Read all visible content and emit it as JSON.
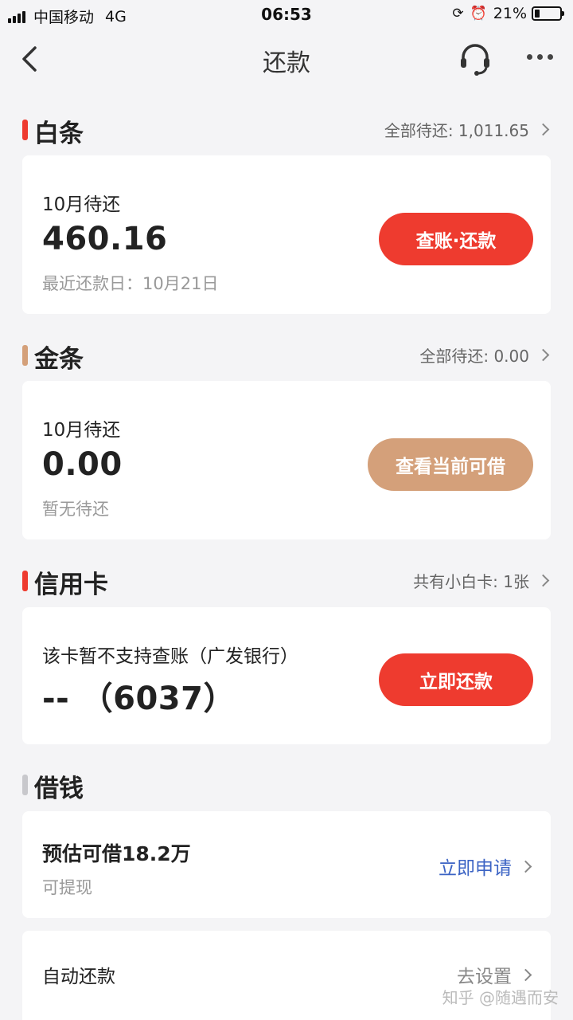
{
  "status_bar": {
    "carrier": "中国移动",
    "network": "4G",
    "time": "06:53",
    "battery": "21%",
    "battery_level": 0.21
  },
  "nav": {
    "title": "还款",
    "back_icon": "chevron-left-icon",
    "service_icon": "headset-icon",
    "more_icon": "more-dots-icon"
  },
  "baitiao": {
    "title": "白条",
    "summary": "全部待还: 1,011.65",
    "label": "10月待还",
    "amount": "460.16",
    "sub": "最近还款日：10月21日",
    "button": "查账·还款",
    "accent": "#ee3b2f"
  },
  "jintiao": {
    "title": "金条",
    "summary": "全部待还: 0.00",
    "label": "10月待还",
    "amount": "0.00",
    "sub": "暂无待还",
    "button": "查看当前可借",
    "accent": "#d4a07a"
  },
  "credit_card": {
    "title": "信用卡",
    "summary": "共有小白卡: 1张",
    "label": "该卡暂不支持查账（广发银行）",
    "amount": "-- （6037）",
    "button": "立即还款",
    "accent": "#ee3b2f"
  },
  "loan": {
    "title": "借钱",
    "label": "预估可借18.2万",
    "sub": "可提现",
    "link": "立即申请",
    "accent": "#c8c8cc",
    "link_color": "#3b63c4"
  },
  "auto_repay": {
    "label": "自动还款",
    "link": "去设置"
  },
  "watermark": "知乎 @随遇而安"
}
